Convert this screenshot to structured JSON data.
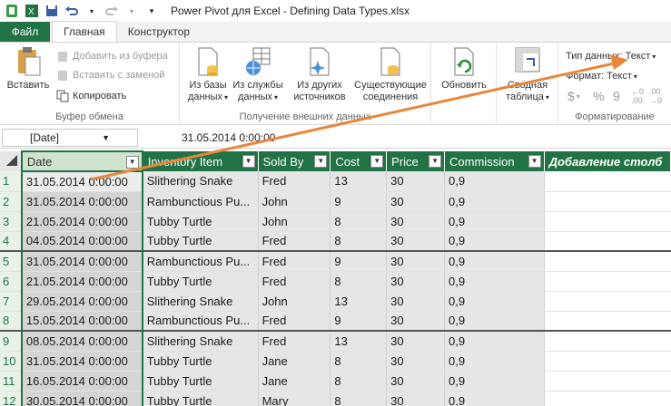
{
  "app": {
    "title": "Power Pivot для Excel - Defining Data Types.xlsx"
  },
  "tabs": {
    "file": "Файл",
    "home": "Главная",
    "design": "Конструктор"
  },
  "ribbon": {
    "clipboard": {
      "paste": "Вставить",
      "add_from_clipboard": "Добавить из буфера",
      "paste_replace": "Вставить с заменой",
      "copy": "Копировать",
      "label": "Буфер обмена"
    },
    "external": {
      "from_db_1": "Из базы",
      "from_db_2": "данных",
      "from_service_1": "Из службы",
      "from_service_2": "данных",
      "from_other_1": "Из других",
      "from_other_2": "источников",
      "existing_1": "Существующие",
      "existing_2": "соединения",
      "label": "Получение внешних данных"
    },
    "refresh": {
      "label": "Обновить"
    },
    "pivot": {
      "line1": "Сводная",
      "line2": "таблица"
    },
    "formatting": {
      "data_type": "Тип данных: Текст",
      "format": "Формат: Текст",
      "currency": "$",
      "percent": "%",
      "thousands": "9",
      "label": "Форматирование"
    }
  },
  "formula_bar": {
    "name_box": "[Date]",
    "value": "31.05.2014 0:00:00"
  },
  "grid": {
    "columns": [
      "Date",
      "Inventory Item",
      "Sold By",
      "Cost",
      "Price",
      "Commission",
      "Добавление столб"
    ],
    "rows": [
      {
        "n": "1",
        "date": "31.05.2014 0:00:00",
        "item": "Slithering Snake",
        "by": "Fred",
        "cost": "13",
        "price": "30",
        "comm": "0,9"
      },
      {
        "n": "2",
        "date": "31.05.2014 0:00:00",
        "item": "Rambunctious Pu...",
        "by": "John",
        "cost": "9",
        "price": "30",
        "comm": "0,9"
      },
      {
        "n": "3",
        "date": "21.05.2014 0:00:00",
        "item": "Tubby Turtle",
        "by": "John",
        "cost": "8",
        "price": "30",
        "comm": "0,9"
      },
      {
        "n": "4",
        "date": "04.05.2014 0:00:00",
        "item": "Tubby Turtle",
        "by": "Fred",
        "cost": "8",
        "price": "30",
        "comm": "0,9"
      },
      {
        "n": "5",
        "date": "31.05.2014 0:00:00",
        "item": "Rambunctious Pu...",
        "by": "Fred",
        "cost": "9",
        "price": "30",
        "comm": "0,9"
      },
      {
        "n": "6",
        "date": "21.05.2014 0:00:00",
        "item": "Tubby Turtle",
        "by": "Fred",
        "cost": "8",
        "price": "30",
        "comm": "0,9"
      },
      {
        "n": "7",
        "date": "29.05.2014 0:00:00",
        "item": "Slithering Snake",
        "by": "John",
        "cost": "13",
        "price": "30",
        "comm": "0,9"
      },
      {
        "n": "8",
        "date": "15.05.2014 0:00:00",
        "item": "Rambunctious Pu...",
        "by": "Fred",
        "cost": "9",
        "price": "30",
        "comm": "0,9"
      },
      {
        "n": "9",
        "date": "08.05.2014 0:00:00",
        "item": "Slithering Snake",
        "by": "Fred",
        "cost": "13",
        "price": "30",
        "comm": "0,9"
      },
      {
        "n": "10",
        "date": "31.05.2014 0:00:00",
        "item": "Tubby Turtle",
        "by": "Jane",
        "cost": "8",
        "price": "30",
        "comm": "0,9"
      },
      {
        "n": "11",
        "date": "16.05.2014 0:00:00",
        "item": "Tubby Turtle",
        "by": "Jane",
        "cost": "8",
        "price": "30",
        "comm": "0,9"
      },
      {
        "n": "12",
        "date": "30.05.2014 0:00:00",
        "item": "Tubby Turtle",
        "by": "Mary",
        "cost": "8",
        "price": "30",
        "comm": "0,9"
      }
    ]
  },
  "colors": {
    "accent": "#217346",
    "arrow": "#e8863a"
  }
}
